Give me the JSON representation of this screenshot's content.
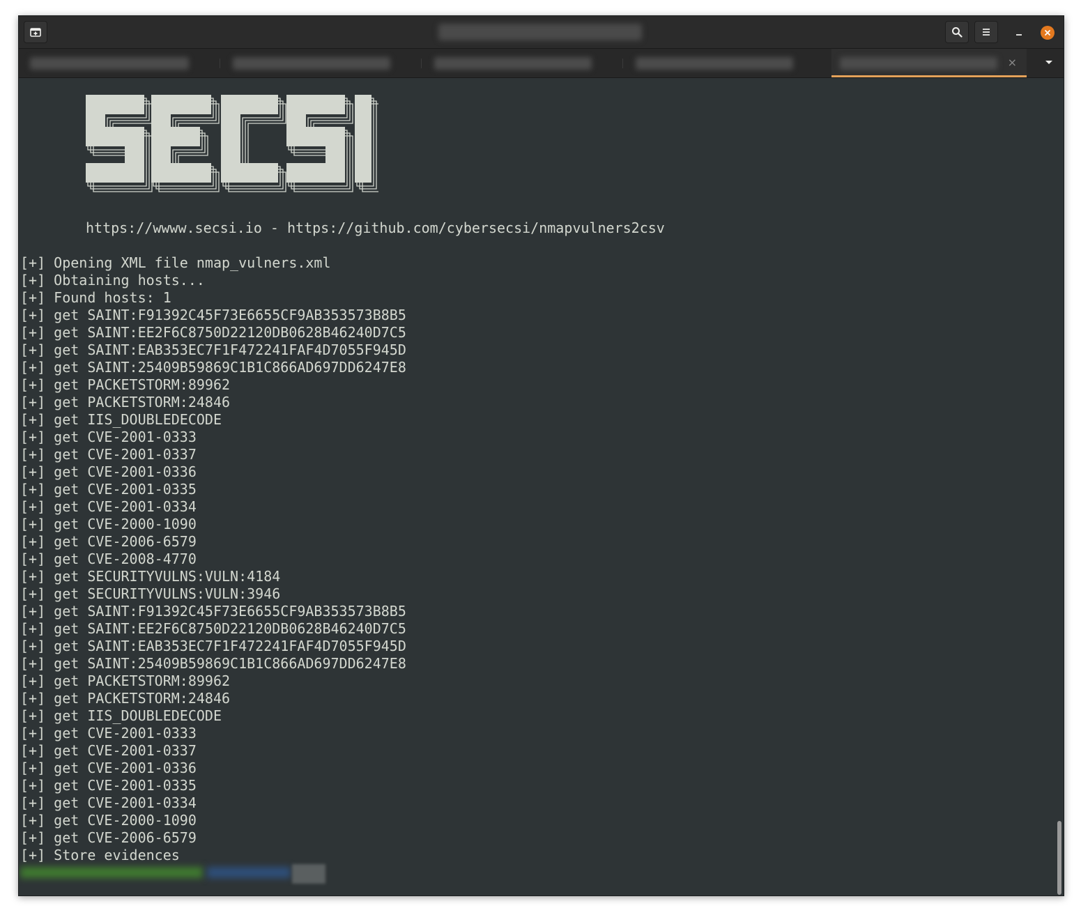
{
  "window": {
    "icons": {
      "new_tab": "new-tab-icon",
      "search": "search-icon",
      "menu": "hamburger-menu-icon",
      "minimize": "minimize-icon",
      "close": "close-icon",
      "tab_close": "×"
    },
    "accent_color": "#e4791f",
    "tab_indicator_color": "#e4a25a"
  },
  "terminal": {
    "banner_text": "SECSI",
    "url_line": "https://wwww.secsi.io - https://github.com/cybersecsi/nmapvulners2csv",
    "log": [
      "[+] Opening XML file nmap_vulners.xml",
      "[+] Obtaining hosts...",
      "[+] Found hosts: 1",
      "[+] get SAINT:F91392C45F73E6655CF9AB353573B8B5",
      "[+] get SAINT:EE2F6C8750D22120DB0628B46240D7C5",
      "[+] get SAINT:EAB353EC7F1F472241FAF4D7055F945D",
      "[+] get SAINT:25409B59869C1B1C866AD697DD6247E8",
      "[+] get PACKETSTORM:89962",
      "[+] get PACKETSTORM:24846",
      "[+] get IIS_DOUBLEDECODE",
      "[+] get CVE-2001-0333",
      "[+] get CVE-2001-0337",
      "[+] get CVE-2001-0336",
      "[+] get CVE-2001-0335",
      "[+] get CVE-2001-0334",
      "[+] get CVE-2000-1090",
      "[+] get CVE-2006-6579",
      "[+] get CVE-2008-4770",
      "[+] get SECURITYVULNS:VULN:4184",
      "[+] get SECURITYVULNS:VULN:3946",
      "[+] get SAINT:F91392C45F73E6655CF9AB353573B8B5",
      "[+] get SAINT:EE2F6C8750D22120DB0628B46240D7C5",
      "[+] get SAINT:EAB353EC7F1F472241FAF4D7055F945D",
      "[+] get SAINT:25409B59869C1B1C866AD697DD6247E8",
      "[+] get PACKETSTORM:89962",
      "[+] get PACKETSTORM:24846",
      "[+] get IIS_DOUBLEDECODE",
      "[+] get CVE-2001-0333",
      "[+] get CVE-2001-0337",
      "[+] get CVE-2001-0336",
      "[+] get CVE-2001-0335",
      "[+] get CVE-2001-0334",
      "[+] get CVE-2000-1090",
      "[+] get CVE-2006-6579",
      "[+] Store evidences"
    ],
    "colors": {
      "background": "#2e3436",
      "foreground": "#d3d7cf"
    }
  }
}
